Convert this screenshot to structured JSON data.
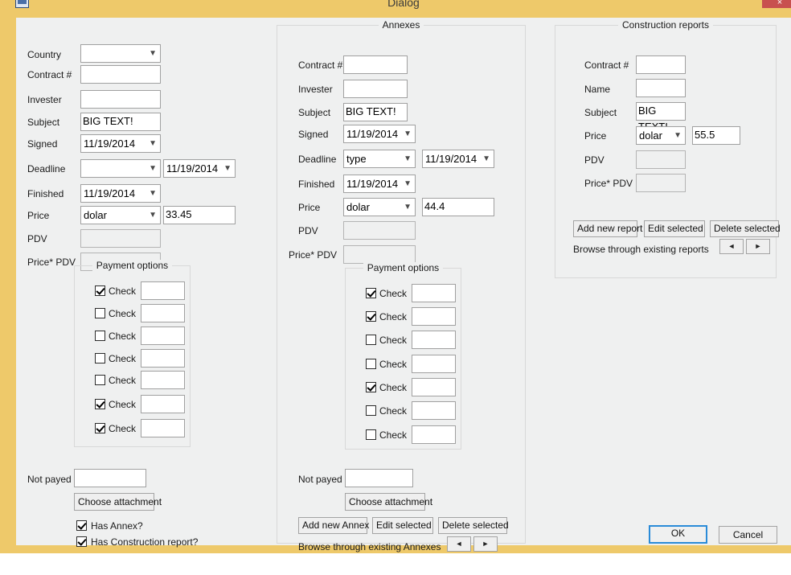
{
  "window": {
    "title": "Dialog",
    "icon": "app-icon",
    "close_label": "×",
    "frame_color": "#eec96a",
    "client_color": "#eff0f0",
    "accent_color": "#2a8bd8"
  },
  "contract": {
    "fields": {
      "country": {
        "label": "Country",
        "value": "",
        "type": "combo"
      },
      "contract_no": {
        "label": "Contract #",
        "value": ""
      },
      "invester": {
        "label": "Invester",
        "value": ""
      },
      "subject": {
        "label": "Subject",
        "value": "BIG TEXT!"
      },
      "signed": {
        "label": "Signed",
        "value": "11/19/2014",
        "type": "combo"
      },
      "deadline": {
        "label": "Deadline",
        "type_value": "",
        "date_value": "11/19/2014"
      },
      "finished": {
        "label": "Finished",
        "value": "11/19/2014",
        "type": "combo"
      },
      "price": {
        "label": "Price",
        "currency": "dolar",
        "amount": "33.45"
      },
      "pdv": {
        "label": "PDV",
        "value": "",
        "disabled": true
      },
      "price_pdv": {
        "label": "Price* PDV",
        "value": "",
        "disabled": true
      },
      "not_payed": {
        "label": "Not payed",
        "value": ""
      }
    },
    "payment_options": {
      "title": "Payment options",
      "rows": [
        {
          "label": "Check",
          "checked": true,
          "value": ""
        },
        {
          "label": "Check",
          "checked": false,
          "value": ""
        },
        {
          "label": "Check",
          "checked": false,
          "value": ""
        },
        {
          "label": "Check",
          "checked": false,
          "value": ""
        },
        {
          "label": "Check",
          "checked": false,
          "value": ""
        },
        {
          "label": "Check",
          "checked": true,
          "value": ""
        },
        {
          "label": "Check",
          "checked": true,
          "value": ""
        }
      ]
    },
    "attachment_button": "Choose attachment",
    "has_annex": {
      "label": "Has Annex?",
      "checked": true
    },
    "has_construction_report": {
      "label": "Has Construction report?",
      "checked": true
    }
  },
  "annexes": {
    "title": "Annexes",
    "fields": {
      "contract_no": {
        "label": "Contract #",
        "value": ""
      },
      "invester": {
        "label": "Invester",
        "value": ""
      },
      "subject": {
        "label": "Subject",
        "value": "BIG TEXT!"
      },
      "signed": {
        "label": "Signed",
        "value": "11/19/2014",
        "type": "combo"
      },
      "deadline": {
        "label": "Deadline",
        "type_value": "type",
        "date_value": "11/19/2014"
      },
      "finished": {
        "label": "Finished",
        "value": "11/19/2014",
        "type": "combo"
      },
      "price": {
        "label": "Price",
        "currency": "dolar",
        "amount": "44.4"
      },
      "pdv": {
        "label": "PDV",
        "value": "",
        "disabled": true
      },
      "price_pdv": {
        "label": "Price* PDV",
        "value": "",
        "disabled": true
      },
      "not_payed": {
        "label": "Not payed",
        "value": ""
      }
    },
    "payment_options": {
      "title": "Payment options",
      "rows": [
        {
          "label": "Check",
          "checked": true,
          "value": ""
        },
        {
          "label": "Check",
          "checked": true,
          "value": ""
        },
        {
          "label": "Check",
          "checked": false,
          "value": ""
        },
        {
          "label": "Check",
          "checked": false,
          "value": ""
        },
        {
          "label": "Check",
          "checked": true,
          "value": ""
        },
        {
          "label": "Check",
          "checked": false,
          "value": ""
        },
        {
          "label": "Check",
          "checked": false,
          "value": ""
        }
      ]
    },
    "attachment_button": "Choose attachment",
    "actions": {
      "add": "Add new Annex",
      "edit": "Edit selected",
      "delete": "Delete selected"
    },
    "browse": {
      "label": "Browse through existing Annexes",
      "prev": "◄",
      "next": "►"
    }
  },
  "construction_reports": {
    "title": "Construction reports",
    "fields": {
      "contract_no": {
        "label": "Contract #",
        "value": ""
      },
      "name": {
        "label": "Name",
        "value": ""
      },
      "subject": {
        "label": "Subject",
        "value": "BIG TEXT!"
      },
      "price": {
        "label": "Price",
        "currency": "dolar",
        "amount": "55.5"
      },
      "pdv": {
        "label": "PDV",
        "value": "",
        "disabled": true
      },
      "price_pdv": {
        "label": "Price* PDV",
        "value": "",
        "disabled": true
      }
    },
    "actions": {
      "add": "Add new report",
      "edit": "Edit selected",
      "delete": "Delete selected"
    },
    "browse": {
      "label": "Browse through existing reports",
      "prev": "◄",
      "next": "►"
    }
  },
  "dialog_buttons": {
    "ok": "OK",
    "cancel": "Cancel"
  }
}
